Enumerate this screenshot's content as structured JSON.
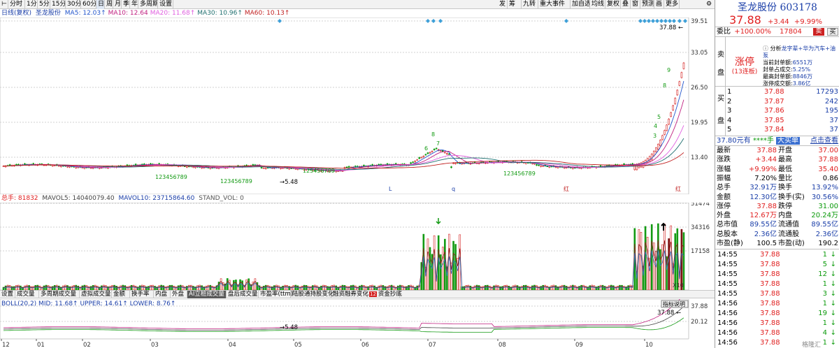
{
  "toolbar": {
    "left_icon": "⊢",
    "periods": [
      "分时",
      "1分",
      "5分",
      "15分",
      "30分",
      "60分",
      "日",
      "周",
      "月",
      "季",
      "年",
      "多周期",
      "设置"
    ],
    "active_period": "日",
    "right_buttons": [
      "发",
      "筹",
      "九转",
      "重大事件",
      "加自选",
      "均线",
      "复权",
      "叠",
      "窗",
      "预测",
      "画",
      "更多"
    ],
    "settings_icon": "gear-icon"
  },
  "main_chart": {
    "legend_period": "日线(复权)",
    "legend_name": "圣龙股份",
    "legend_ma": [
      {
        "label": "MA5: 12.03↑",
        "color": "#2255cc"
      },
      {
        "label": "MA10: 12.64",
        "color": "#c02080"
      },
      {
        "label": "MA20: 11.68↑",
        "color": "#e060e0"
      },
      {
        "label": "MA30: 10.96↑",
        "color": "#207070"
      },
      {
        "label": "MA60: 10.13↑",
        "color": "#c02020"
      }
    ],
    "price_axis": [
      "39.51",
      "33.05",
      "26.50",
      "19.95",
      "13.40"
    ],
    "high_label": "37.88",
    "low_label": "5.48",
    "count_labels": [
      "123456789",
      "123456789",
      "123456789",
      "123456789"
    ],
    "markers": [
      "L",
      "q",
      "红",
      "红"
    ],
    "tag_labels": [
      "8",
      "7",
      "6",
      "9",
      "8",
      "4",
      "5",
      "3"
    ]
  },
  "volume_chart": {
    "legend_title": "总手: 81832",
    "mavol5": "MAVOL5: 14040079.40",
    "mavol10": "MAVOL10: 23715864.60",
    "stand": "STAND_VOL: 0",
    "axis": [
      "51474",
      "34316",
      "17158"
    ],
    "unit": "X10"
  },
  "tabs": {
    "items": [
      "设置",
      "成交量",
      "多周期成交量",
      "虚拟成交量",
      "金额",
      "换手率",
      "内盘",
      "外盘",
      "AI立桩成交量",
      "盘后成交量",
      "市盈率(ttm)",
      "陆股通持股变化",
      "融资融券变化",
      "资金抄底"
    ],
    "active": "AI立桩成交量",
    "badge": "12"
  },
  "boll_chart": {
    "legend": "BOLL(20,2) MID: 11.68↑ UPPER: 14.61↑ LOWER: 8.76↑",
    "axis": [
      "37.88",
      "20.12"
    ],
    "high_label": "37.88",
    "low_label": "5.48",
    "indicator_btn": "指标说明"
  },
  "x_axis": [
    "12",
    "01",
    "02",
    "03",
    "04",
    "05",
    "06",
    "07",
    "08",
    "09",
    "10"
  ],
  "watermark": "格隆汇",
  "quote": {
    "name_code": "圣龙股份 603178",
    "price": "37.88",
    "change": "+3.44",
    "pct": "+9.99%",
    "weibi_label": "委比",
    "weibi_value": "+100.00%",
    "weibi_diff": "17804",
    "sell_btn": "卖",
    "buy_btn": "买",
    "sell_side": "卖盘",
    "limit_state": "涨停",
    "limit_days": "(13连板)",
    "analysis": "分析",
    "analysis_tags": "龙字辈+华为汽车+油泵",
    "seal_lines": [
      {
        "label": "当前封单额:",
        "value": "6551万"
      },
      {
        "label": "封单占成交:",
        "value": "5.25%"
      },
      {
        "label": "最高封单额:",
        "value": "8846万"
      },
      {
        "label": "涨停成交额:",
        "value": "3.86亿"
      }
    ],
    "buy_side": "买盘",
    "bids": [
      {
        "level": "1",
        "price": "37.88",
        "vol": "17293"
      },
      {
        "level": "2",
        "price": "37.87",
        "vol": "242"
      },
      {
        "level": "3",
        "price": "37.86",
        "vol": "195"
      },
      {
        "level": "4",
        "price": "37.85",
        "vol": "37"
      },
      {
        "level": "5",
        "price": "37.84",
        "vol": "37"
      }
    ],
    "big_order_price": "37.80元有",
    "big_order_hidden": "****手",
    "big_order_link": "大买单",
    "check_link": "点击查看",
    "stats": [
      {
        "l1": "最新",
        "v1": "37.88",
        "c1": "red",
        "l2": "开盘",
        "v2": "37.00",
        "c2": "red"
      },
      {
        "l1": "涨跌",
        "v1": "+3.44",
        "c1": "red",
        "l2": "最高",
        "v2": "37.88",
        "c2": "red"
      },
      {
        "l1": "涨幅",
        "v1": "+9.99%",
        "c1": "red",
        "l2": "最低",
        "v2": "35.40",
        "c2": "red"
      },
      {
        "l1": "振幅",
        "v1": "7.20%",
        "c1": "black",
        "l2": "量比",
        "v2": "0.86",
        "c2": "black"
      },
      {
        "l1": "总手",
        "v1": "32.91万",
        "c1": "blue",
        "l2": "换手",
        "v2": "13.92%",
        "c2": "blue"
      },
      {
        "l1": "金额",
        "v1": "12.30亿",
        "c1": "blue",
        "l2": "换手(实)",
        "v2": "30.56%",
        "c2": "blue"
      },
      {
        "l1": "涨停",
        "v1": "37.88",
        "c1": "red",
        "l2": "跌停",
        "v2": "31.00",
        "c2": "green"
      },
      {
        "l1": "外盘",
        "v1": "12.67万",
        "c1": "red",
        "l2": "内盘",
        "v2": "20.24万",
        "c2": "green"
      },
      {
        "l1": "总市值",
        "v1": "89.55亿",
        "c1": "blue",
        "l2": "流通值",
        "v2": "89.55亿",
        "c2": "blue"
      },
      {
        "l1": "总股本",
        "v1": "2.36亿",
        "c1": "blue",
        "l2": "流通股",
        "v2": "2.36亿",
        "c2": "blue"
      },
      {
        "l1": "市盈(静)",
        "v1": "100.5",
        "c1": "black",
        "l2": "市盈(动)",
        "v2": "190.2",
        "c2": "black"
      }
    ],
    "ticks": [
      {
        "time": "14:55",
        "price": "37.88",
        "vol": "1",
        "dir": "down"
      },
      {
        "time": "14:55",
        "price": "37.88",
        "vol": "5",
        "dir": "down"
      },
      {
        "time": "14:55",
        "price": "37.88",
        "vol": "12",
        "dir": "down"
      },
      {
        "time": "14:55",
        "price": "37.88",
        "vol": "1",
        "dir": "down"
      },
      {
        "time": "14:55",
        "price": "37.88",
        "vol": "3",
        "dir": "down"
      },
      {
        "time": "14:56",
        "price": "37.88",
        "vol": "1",
        "dir": "down"
      },
      {
        "time": "14:56",
        "price": "37.88",
        "vol": "19",
        "dir": "down"
      },
      {
        "time": "14:56",
        "price": "37.88",
        "vol": "1",
        "dir": "down"
      },
      {
        "time": "14:56",
        "price": "37.88",
        "vol": "4",
        "dir": "down"
      },
      {
        "time": "14:56",
        "price": "37.88",
        "vol": "1",
        "dir": "down"
      }
    ]
  }
}
